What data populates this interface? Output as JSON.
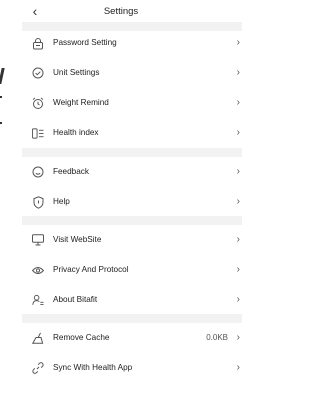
{
  "header": {
    "title": "Settings",
    "back_icon": "chevron-left-icon"
  },
  "groups": [
    {
      "items": [
        {
          "label": "Password Setting",
          "icon": "lock-icon"
        },
        {
          "label": "Unit Settings",
          "icon": "check-circle-icon"
        },
        {
          "label": "Weight Remind",
          "icon": "alarm-clock-icon"
        },
        {
          "label": "Health index",
          "icon": "index-list-icon"
        }
      ]
    },
    {
      "items": [
        {
          "label": "Feedback",
          "icon": "smile-icon"
        },
        {
          "label": "Help",
          "icon": "shield-icon"
        }
      ]
    },
    {
      "items": [
        {
          "label": "Visit WebSite",
          "icon": "monitor-icon"
        },
        {
          "label": "Privacy And Protocol",
          "icon": "eye-icon"
        },
        {
          "label": "About Bitafit",
          "icon": "user-info-icon"
        }
      ]
    },
    {
      "items": [
        {
          "label": "Remove Cache",
          "value": "0.0KB",
          "icon": "broom-icon"
        },
        {
          "label": "Sync With Health App",
          "icon": "link-icon"
        }
      ]
    }
  ],
  "chevron": "›",
  "colors": {
    "separator": "#f2f2f2",
    "text": "#222222",
    "icon": "#555555"
  }
}
